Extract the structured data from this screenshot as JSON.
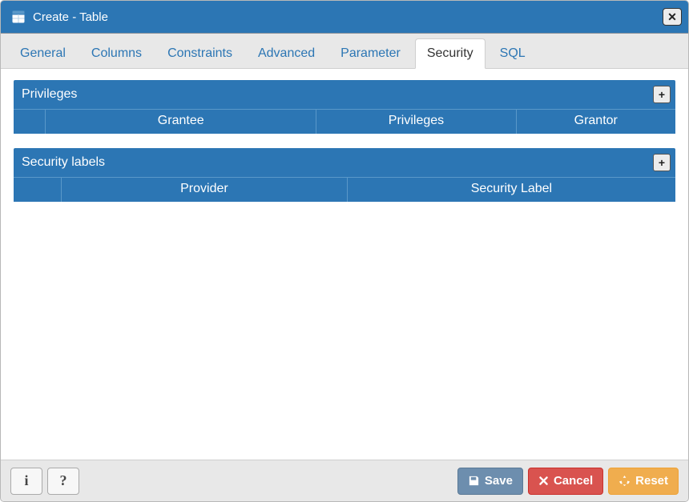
{
  "window": {
    "title": "Create - Table"
  },
  "tabs": [
    {
      "label": "General",
      "active": false
    },
    {
      "label": "Columns",
      "active": false
    },
    {
      "label": "Constraints",
      "active": false
    },
    {
      "label": "Advanced",
      "active": false
    },
    {
      "label": "Parameter",
      "active": false
    },
    {
      "label": "Security",
      "active": true
    },
    {
      "label": "SQL",
      "active": false
    }
  ],
  "sections": {
    "privileges": {
      "title": "Privileges",
      "columns": [
        "Grantee",
        "Privileges",
        "Grantor"
      ],
      "rows": []
    },
    "security_labels": {
      "title": "Security labels",
      "columns": [
        "Provider",
        "Security Label"
      ],
      "rows": []
    }
  },
  "footer": {
    "info_symbol": "i",
    "help_symbol": "?",
    "save": "Save",
    "cancel": "Cancel",
    "reset": "Reset"
  },
  "icons": {
    "close": "✕",
    "plus": "+"
  }
}
